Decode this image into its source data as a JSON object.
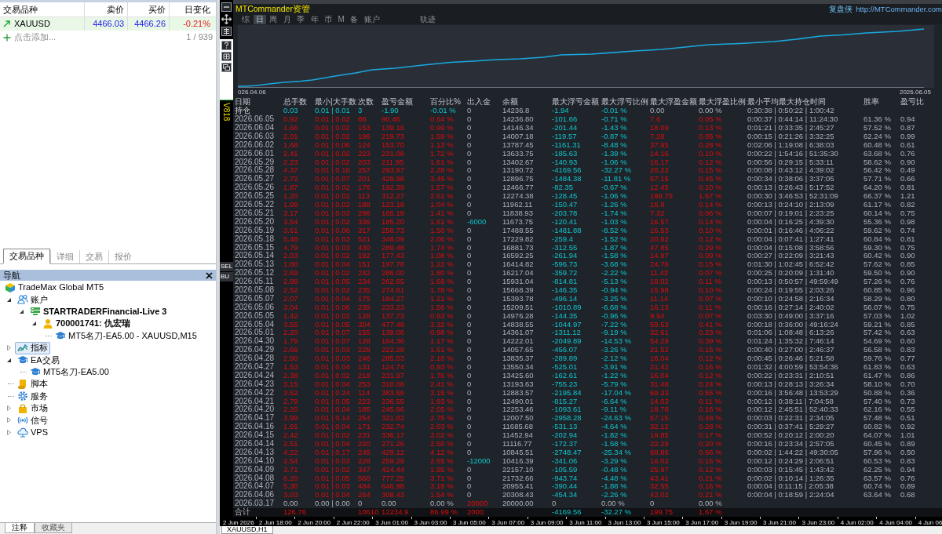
{
  "market_watch": {
    "columns": [
      "交易品种",
      "卖价",
      "买价",
      "日变化"
    ],
    "rows": [
      {
        "symbol": "XAUUSD",
        "kind": "rising",
        "bid": "4466.03",
        "ask": "4466.26",
        "change": "-0.21%",
        "selected": true
      }
    ],
    "add_label": "点击添加...",
    "count": "1 / 939"
  },
  "panel_tabs": [
    {
      "label": "交易品种",
      "selected": true
    },
    {
      "label": "详细",
      "selected": false
    },
    {
      "label": "交易",
      "selected": false
    },
    {
      "label": "报价",
      "selected": false
    }
  ],
  "navigator": {
    "title": "导航",
    "tree": [
      {
        "label": "TradeMax Global MT5",
        "kind": "broker",
        "selected": false,
        "children": [
          {
            "label": "账户",
            "kind": "accounts",
            "expanded": true,
            "selected": false,
            "children": [
              {
                "label": "STARTRADERFinancial-Live 3",
                "kind": "server",
                "expanded": true,
                "selected": false,
                "children": [
                  {
                    "label": "700001741: 仇宏瑞",
                    "kind": "account",
                    "expanded": true,
                    "selected": false,
                    "children": [
                      {
                        "label": "MT5名刀-EA5.00 - XAUUSD,M15",
                        "kind": "running_expert",
                        "selected": false
                      }
                    ]
                  }
                ]
              }
            ]
          },
          {
            "label": "指标",
            "kind": "indicators",
            "expanded": false,
            "selected": true
          },
          {
            "label": "EA交易",
            "kind": "experts",
            "expanded": true,
            "selected": false,
            "children": [
              {
                "label": "MT5名刀-EA5.00",
                "kind": "expert",
                "selected": false
              }
            ]
          },
          {
            "label": "脚本",
            "kind": "scripts",
            "selected": false
          },
          {
            "label": "服务",
            "kind": "services",
            "selected": false
          },
          {
            "label": "市场",
            "kind": "market",
            "expanded": false,
            "selected": false
          },
          {
            "label": "信号",
            "kind": "signals",
            "expanded": false,
            "selected": false
          },
          {
            "label": "VPS",
            "kind": "vps",
            "expanded": false,
            "selected": false
          }
        ]
      }
    ]
  },
  "bottom_tabs": [
    {
      "label": "注释",
      "selected": true
    },
    {
      "label": "收藏夹",
      "selected": false
    }
  ],
  "ea_panel": {
    "version_label": "V818",
    "side_tabs": [
      "SEL",
      "BU"
    ],
    "title": "MTCommander资管",
    "brand": "复盘侠",
    "url": "http://MTCommander.com",
    "tabs": [
      {
        "label": "综",
        "selected": false
      },
      {
        "label": "日",
        "selected": true
      },
      {
        "label": "周",
        "selected": false
      },
      {
        "label": "月",
        "selected": false
      },
      {
        "label": "季",
        "selected": false
      },
      {
        "label": "年",
        "selected": false
      },
      {
        "label": "币",
        "selected": false
      },
      {
        "label": "M",
        "selected": false
      },
      {
        "label": "备",
        "selected": false
      },
      {
        "label": "账户",
        "selected": false
      }
    ],
    "trace_button": "轨迹",
    "chart": {
      "start_label": "026.04.06",
      "end_label": "2026.06.05"
    },
    "table": {
      "columns": [
        "日期",
        "总手数",
        "最小|大手数",
        "次数",
        "盈亏金额",
        "百分比%",
        "出入金",
        "余额",
        "最大浮亏金额",
        "最大浮亏比例",
        "最大浮盈金额",
        "最大浮盈比例",
        "最小平均最大持仓时间",
        "胜率",
        "盈亏比"
      ],
      "rows": [
        {
          "kind": "open_positions",
          "cells": [
            "持仓",
            "0.03",
            "0.01 | 0.01",
            "3",
            "-1.90",
            "-0.01 %",
            "0",
            "14236.8",
            "-1.94",
            "-0.01 %",
            "0.00",
            "0.00 %",
            "0:30:38 | 0:50:22 | 1:00:42"
          ]
        },
        {
          "kind": "day",
          "cells": [
            "2026.06.05",
            "0.92",
            "0.01 | 0.02",
            "88",
            "90.46",
            "0.64 %",
            "0",
            "14236.80",
            "-101.66",
            "-0.71 %",
            "7.6",
            "0.05 %",
            "0:00:37 | 0:44:14 | 11:24:30",
            "61.36 %",
            "0.94"
          ]
        },
        {
          "kind": "day",
          "cells": [
            "2026.06.04",
            "1.66",
            "0.01 | 0.02",
            "153",
            "139.16",
            "0.99 %",
            "0",
            "14146.34",
            "-201.44",
            "-1.43 %",
            "18.09",
            "0.13 %",
            "0:01:21 | 0:33:35 | 2:45:27",
            "57.52 %",
            "0.87"
          ]
        },
        {
          "kind": "day",
          "cells": [
            "2026.06.03",
            "2.01",
            "0.01 | 0.02",
            "196",
            "219.73",
            "1.59 %",
            "0",
            "14007.18",
            "-119.57",
            "-0.87 %",
            "7.28",
            "0.05 %",
            "0:00:15 | 0:21:26 | 3:32:25",
            "62.24 %",
            "0.99"
          ]
        },
        {
          "kind": "day",
          "cells": [
            "2026.06.02",
            "1.68",
            "0.01 | 0.06",
            "124",
            "153.70",
            "1.13 %",
            "0",
            "13787.45",
            "-1161.31",
            "-8.48 %",
            "37.95",
            "0.28 %",
            "0:02:06 | 1:19:08 | 6:38:03",
            "60.48 %",
            "0.61"
          ]
        },
        {
          "kind": "day",
          "cells": [
            "2026.06.01",
            "2.41",
            "0.01 | 0.02",
            "223",
            "231.08",
            "1.72 %",
            "0",
            "13633.75",
            "-185.63",
            "-1.39 %",
            "14.16",
            "0.10 %",
            "0:00:22 | 1:54:16 | 51:35:30",
            "63.68 %",
            "0.76"
          ]
        },
        {
          "kind": "day",
          "cells": [
            "2026.05.29",
            "2.23",
            "0.01 | 0.02",
            "203",
            "211.95",
            "1.61 %",
            "0",
            "13402.67",
            "-140.93",
            "-1.06 %",
            "16.17",
            "0.12 %",
            "0:00:56 | 0:29:15 | 5:33:11",
            "58.62 %",
            "0.90"
          ]
        },
        {
          "kind": "day",
          "cells": [
            "2026.05.28",
            "4.37",
            "0.01 | 0.16",
            "257",
            "293.97",
            "2.28 %",
            "0",
            "13190.72",
            "-4169.56",
            "-32.27 %",
            "20.22",
            "0.15 %",
            "0:00:08 | 0:43:12 | 4:39:02",
            "56.42 %",
            "0.49"
          ]
        },
        {
          "kind": "day",
          "cells": [
            "2026.05.27",
            "2.72",
            "0.01 | 0.07",
            "201",
            "429.98",
            "3.45 %",
            "0",
            "12896.75",
            "-1484.38",
            "-11.81 %",
            "57.15",
            "0.45 %",
            "0:00:34 | 0:38:06 | 3:37:05",
            "57.71 %",
            "0.66"
          ]
        },
        {
          "kind": "day",
          "cells": [
            "2026.05.26",
            "1.87",
            "0.01 | 0.02",
            "176",
            "192.39",
            "1.57 %",
            "0",
            "12466.77",
            "-82.35",
            "-0.67 %",
            "12.45",
            "0.10 %",
            "0:00:13 | 0:26:43 | 5:17:52",
            "64.20 %",
            "0.81"
          ]
        },
        {
          "kind": "day",
          "cells": [
            "2026.05.25",
            "1.20",
            "0.01 | 0.02",
            "113",
            "312.27",
            "2.61 %",
            "0",
            "12274.38",
            "-128.45",
            "-1.06 %",
            "199.75",
            "1.67 %",
            "0:00:30 | 3:46:53 | 52:31:09",
            "66.37 %",
            "1.21"
          ]
        },
        {
          "kind": "day",
          "cells": [
            "2026.05.22",
            "1.99",
            "0.01 | 0.02",
            "188",
            "123.18",
            "1.04 %",
            "0",
            "11962.11",
            "-150.47",
            "-1.26 %",
            "16.8",
            "0.14 %",
            "0:00:13 | 0:24:10 | 2:13:09",
            "61.17 %",
            "0.82"
          ]
        },
        {
          "kind": "day",
          "cells": [
            "2026.05.21",
            "3.17",
            "0.01 | 0.03",
            "296",
            "165.18",
            "1.41 %",
            "0",
            "11838.93",
            "-203.78",
            "-1.74 %",
            "7.32",
            "0.06 %",
            "0:00:07 | 0:19:01 | 2:23:25",
            "60.14 %",
            "0.75"
          ]
        },
        {
          "kind": "withdrawal_day",
          "cells": [
            "2026.05.20",
            "3.54",
            "0.01 | 0.02",
            "336",
            "185.20",
            "1.61 %",
            "-6000",
            "11673.75",
            "-120.41",
            "-1.03 %",
            "16.57",
            "0.14 %",
            "0:00:04 | 0:16:25 | 4:39:30",
            "55.36 %",
            "0.98"
          ]
        },
        {
          "kind": "day",
          "cells": [
            "2026.05.19",
            "3.61",
            "0.01 | 0.06",
            "317",
            "258.73",
            "1.50 %",
            "0",
            "17488.55",
            "-1481.88",
            "-8.52 %",
            "16.53",
            "0.10 %",
            "0:00:01 | 0:16:46 | 4:06:22",
            "59.62 %",
            "0.74"
          ]
        },
        {
          "kind": "day",
          "cells": [
            "2026.05.18",
            "5.48",
            "0.01 | 0.03",
            "521",
            "348.09",
            "2.06 %",
            "0",
            "17229.82",
            "-259.4",
            "-1.52 %",
            "20.82",
            "0.12 %",
            "0:00:04 | 0:07:41 | 1:27:41",
            "60.84 %",
            "0.81"
          ]
        },
        {
          "kind": "day",
          "cells": [
            "2026.05.15",
            "4.79",
            "0.01 | 0.03",
            "430",
            "289.48",
            "1.74 %",
            "0",
            "16881.73",
            "-312.55",
            "-1.87 %",
            "47.85",
            "0.29 %",
            "0:00:04 | 0:15:08 | 3:58:56",
            "59.30 %",
            "0.75"
          ]
        },
        {
          "kind": "day",
          "cells": [
            "2026.05.14",
            "2.03",
            "0.01 | 0.02",
            "192",
            "177.43",
            "1.08 %",
            "0",
            "16592.25",
            "-261.94",
            "-1.58 %",
            "14.97",
            "0.09 %",
            "0:00:27 | 0:22:09 | 3:21:43",
            "60.42 %",
            "0.90"
          ]
        },
        {
          "kind": "day",
          "cells": [
            "2026.05.13",
            "1.80",
            "0.01 | 0.04",
            "151",
            "197.78",
            "1.22 %",
            "0",
            "16414.82",
            "-596.73",
            "-3.68 %",
            "24.76",
            "0.15 %",
            "0:01:30 | 1:02:45 | 6:52:42",
            "57.62 %",
            "0.85"
          ]
        },
        {
          "kind": "day",
          "cells": [
            "2026.05.12",
            "2.69",
            "0.01 | 0.02",
            "242",
            "286.00",
            "1.80 %",
            "0",
            "16217.04",
            "-359.72",
            "-2.22 %",
            "11.43",
            "0.07 %",
            "0:00:25 | 0:20:09 | 1:31:40",
            "59.50 %",
            "0.90"
          ]
        },
        {
          "kind": "day",
          "cells": [
            "2026.05.11",
            "2.88",
            "0.01 | 0.05",
            "234",
            "262.65",
            "1.68 %",
            "0",
            "15931.04",
            "-814.81",
            "-5.13 %",
            "18.02",
            "0.11 %",
            "0:00:13 | 0:50:57 | 49:59:49",
            "57.26 %",
            "0.76"
          ]
        },
        {
          "kind": "day",
          "cells": [
            "2026.05.08",
            "2.52",
            "0.01 | 0.02",
            "235",
            "274.61",
            "1.78 %",
            "0",
            "15668.39",
            "-146.35",
            "-0.94 %",
            "15.98",
            "0.10 %",
            "0:00:24 | 0:19:55 | 2:03:26",
            "60.85 %",
            "0.96"
          ]
        },
        {
          "kind": "day",
          "cells": [
            "2026.05.07",
            "2.07",
            "0.01 | 0.04",
            "175",
            "184.27",
            "1.21 %",
            "0",
            "15393.78",
            "-496.14",
            "-3.25 %",
            "11.14",
            "0.07 %",
            "0:00:10 | 0:24:58 | 2:16:34",
            "58.29 %",
            "0.80"
          ]
        },
        {
          "kind": "day",
          "cells": [
            "2026.05.06",
            "3.04",
            "0.01 | 0.06",
            "239",
            "233.23",
            "1.56 %",
            "0",
            "15209.51",
            "-1010.89",
            "-6.68 %",
            "16.13",
            "0.11 %",
            "0:00:16 | 0:27:14 | 2:40:02",
            "56.07 %",
            "0.75"
          ]
        },
        {
          "kind": "day",
          "cells": [
            "2026.05.05",
            "1.42",
            "0.01 | 0.02",
            "128",
            "137.73",
            "0.93 %",
            "0",
            "14976.28",
            "-144.35",
            "-0.96 %",
            "9.94",
            "0.07 %",
            "0:03:30 | 0:49:00 | 3:37:16",
            "57.03 %",
            "1.02"
          ]
        },
        {
          "kind": "day",
          "cells": [
            "2026.05.04",
            "3.55",
            "0.01 | 0.05",
            "304",
            "477.48",
            "3.32 %",
            "0",
            "14838.55",
            "-1044.97",
            "-7.22 %",
            "59.53",
            "0.41 %",
            "0:00:18 | 0:36:00 | 49:16:24",
            "59.21 %",
            "0.85"
          ]
        },
        {
          "kind": "day",
          "cells": [
            "2026.05.01",
            "2.20",
            "0.01 | 0.07",
            "155",
            "139.06",
            "0.98 %",
            "0",
            "14361.07",
            "-1311.12",
            "-9.19 %",
            "32.61",
            "0.23 %",
            "0:01:06 | 1:08:48 | 6:13:26",
            "57.42 %",
            "0.63"
          ]
        },
        {
          "kind": "day",
          "cells": [
            "2026.04.30",
            "1.79",
            "0.01 | 0.07",
            "128",
            "164.36",
            "1.17 %",
            "0",
            "14222.01",
            "-2049.89",
            "-14.53 %",
            "54.29",
            "0.39 %",
            "0:01:24 | 1:35:32 | 7:46:14",
            "54.69 %",
            "0.60"
          ]
        },
        {
          "kind": "day",
          "cells": [
            "2026.04.29",
            "2.69",
            "0.01 | 0.03",
            "228",
            "222.28",
            "1.61 %",
            "0",
            "14057.65",
            "-456.07",
            "-3.26 %",
            "21.52",
            "0.15 %",
            "0:00:40 | 0:27:00 | 2:46:37",
            "56.58 %",
            "0.83"
          ]
        },
        {
          "kind": "day",
          "cells": [
            "2026.04.28",
            "2.90",
            "0.01 | 0.03",
            "246",
            "285.03",
            "2.10 %",
            "0",
            "13835.37",
            "-289.89",
            "-2.12 %",
            "16.04",
            "0.12 %",
            "0:00:45 | 0:26:46 | 5:21:58",
            "59.76 %",
            "0.77"
          ]
        },
        {
          "kind": "day",
          "cells": [
            "2026.04.27",
            "1.53",
            "0.01 | 0.04",
            "131",
            "124.74",
            "0.93 %",
            "0",
            "13550.34",
            "-525.01",
            "-3.91 %",
            "21.42",
            "0.16 %",
            "0:01:32 | 4:00:59 | 53:54:36",
            "61.83 %",
            "0.63"
          ]
        },
        {
          "kind": "day",
          "cells": [
            "2026.04.24",
            "2.38",
            "0.01 | 0.02",
            "218",
            "231.97",
            "1.76 %",
            "0",
            "13425.60",
            "-162.61",
            "-1.22 %",
            "16.04",
            "0.12 %",
            "0:00:22 | 0:23:31 | 2:10:51",
            "61.47 %",
            "0.86"
          ]
        },
        {
          "kind": "day",
          "cells": [
            "2026.04.23",
            "3.15",
            "0.01 | 0.04",
            "253",
            "310.06",
            "2.41 %",
            "0",
            "13193.63",
            "-755.23",
            "-5.79 %",
            "31.48",
            "0.24 %",
            "0:00:13 | 0:28:13 | 3:26:34",
            "58.10 %",
            "0.70"
          ]
        },
        {
          "kind": "day",
          "cells": [
            "2026.04.22",
            "3.62",
            "0.01 | 0.24",
            "114",
            "383.56",
            "3.15 %",
            "0",
            "12883.57",
            "-2195.84",
            "-17.04 %",
            "69.33",
            "0.55 %",
            "0:00:16 | 3:56:48 | 13:53:29",
            "50.88 %",
            "0.36"
          ]
        },
        {
          "kind": "day",
          "cells": [
            "2026.04.21",
            "2.79",
            "0.01 | 0.05",
            "223",
            "236.55",
            "1.93 %",
            "0",
            "12490.01",
            "-815.27",
            "-6.64 %",
            "14.03",
            "0.11 %",
            "0:00:12 | 0:38:11 | 7:04:58",
            "57.40 %",
            "0.73"
          ]
        },
        {
          "kind": "day",
          "cells": [
            "2026.04.20",
            "2.20",
            "0.01 | 0.04",
            "185",
            "245.96",
            "2.05 %",
            "0",
            "12253.46",
            "-1093.61",
            "-9.11 %",
            "18.78",
            "0.16 %",
            "0:00:12 | 2:45:51 | 52:40:33",
            "62.16 %",
            "0.55"
          ]
        },
        {
          "kind": "day",
          "cells": [
            "2026.04.17",
            "3.99",
            "0.01 | 0.14",
            "254",
            "321.82",
            "2.75 %",
            "0",
            "12007.50",
            "-2958.28",
            "-24.63 %",
            "57.15",
            "0.48 %",
            "0:00:03 | 0:22:31 | 2:34:05",
            "57.48 %",
            "0.51"
          ]
        },
        {
          "kind": "day",
          "cells": [
            "2026.04.16",
            "1.91",
            "0.01 | 0.04",
            "171",
            "232.74",
            "2.03 %",
            "0",
            "11685.68",
            "-531.13",
            "-4.64 %",
            "32.12",
            "0.28 %",
            "0:00:31 | 0:37:41 | 5:29:27",
            "60.82 %",
            "0.92"
          ]
        },
        {
          "kind": "day",
          "cells": [
            "2026.04.15",
            "2.42",
            "0.01 | 0.02",
            "231",
            "336.17",
            "3.02 %",
            "0",
            "11452.94",
            "-202.94",
            "-1.82 %",
            "19.85",
            "0.17 %",
            "0:00:52 | 0:20:12 | 2:00:20",
            "64.07 %",
            "1.01"
          ]
        },
        {
          "kind": "day",
          "cells": [
            "2026.04.14",
            "2.51",
            "0.01 | 0.04",
            "220",
            "271.26",
            "2.50 %",
            "0",
            "11116.77",
            "-172.37",
            "-1.58 %",
            "22.29",
            "0.20 %",
            "0:00:16 | 0:23:34 | 2:57:05",
            "60.45 %",
            "0.89"
          ]
        },
        {
          "kind": "day",
          "cells": [
            "2026.04.13",
            "4.22",
            "0.01 | 0.17",
            "245",
            "429.12",
            "4.12 %",
            "0",
            "10845.51",
            "-2748.47",
            "-25.34 %",
            "69.86",
            "0.66 %",
            "0:00:02 | 1:44:22 | 49:30:05",
            "57.96 %",
            "0.50"
          ]
        },
        {
          "kind": "withdrawal_day",
          "cells": [
            "2026.04.10",
            "2.54",
            "0.01 | 0.03",
            "228",
            "259.29",
            "2.55 %",
            "-12000",
            "10416.39",
            "-341.06",
            "-3.29 %",
            "16.02",
            "0.16 %",
            "0:00:12 | 0:24:29 | 2:06:51",
            "60.53 %",
            "0.83"
          ]
        },
        {
          "kind": "day",
          "cells": [
            "2026.04.09",
            "3.71",
            "0.01 | 0.02",
            "347",
            "424.44",
            "1.95 %",
            "0",
            "22157.10",
            "-105.59",
            "-0.48 %",
            "25.97",
            "0.12 %",
            "0:00:03 | 0:15:45 | 1:43:42",
            "62.25 %",
            "0.94"
          ]
        },
        {
          "kind": "day",
          "cells": [
            "2026.04.08",
            "6.20",
            "0.01 | 0.05",
            "560",
            "777.25",
            "3.71 %",
            "0",
            "21732.66",
            "-943.74",
            "-4.48 %",
            "43.41",
            "0.21 %",
            "0:00:02 | 0:10:14 | 1:26:35",
            "63.57 %",
            "0.76"
          ]
        },
        {
          "kind": "day",
          "cells": [
            "2026.04.07",
            "5.30",
            "0.01 | 0.03",
            "484",
            "646.98",
            "3.19 %",
            "0",
            "20955.41",
            "-390.44",
            "-1.88 %",
            "32.55",
            "0.16 %",
            "0:00:04 | 0:11:15 | 2:05:38",
            "60.74 %",
            "0.89"
          ]
        },
        {
          "kind": "day",
          "cells": [
            "2026.04.06",
            "3.03",
            "0.01 | 0.04",
            "264",
            "308.43",
            "1.54 %",
            "0",
            "20308.43",
            "-454.34",
            "-2.26 %",
            "42.02",
            "0.21 %",
            "0:00:04 | 0:18:59 | 2:24:04",
            "63.64 %",
            "0.68"
          ]
        },
        {
          "kind": "initial_deposit",
          "cells": [
            "2026.03.17",
            "0.00",
            "0.00 | 0.00",
            "0",
            "0.00",
            "0.00 %",
            "20000",
            "20000.00",
            "0",
            "0.00 %",
            "0",
            "0.00 %"
          ]
        },
        {
          "kind": "total",
          "cells": [
            "合计",
            "126.76",
            null,
            "10610",
            "12234.9",
            "86.99 %",
            "2000",
            null,
            "-4169.56",
            "-32.27 %",
            "199.75",
            "1.67 %"
          ]
        }
      ]
    }
  },
  "time_axis": [
    "2 Jun 2026",
    "2 Jun 18:00",
    "2 Jun 20:00",
    "2 Jun 22:00",
    "3 Jun 01:00",
    "3 Jun 03:00",
    "3 Jun 05:00",
    "3 Jun 07:00",
    "3 Jun 09:00",
    "3 Jun 11:00",
    "3 Jun 13:00",
    "3 Jun 15:00",
    "3 Jun 17:00",
    "3 Jun 19:00",
    "3 Jun 21:00",
    "3 Jun 23:00",
    "4 Jun 02:00",
    "4 Jun 04:00",
    "4 Jun 06"
  ],
  "chart_tabs": [
    {
      "label": "XAUUSD,H1",
      "selected": true
    }
  ]
}
